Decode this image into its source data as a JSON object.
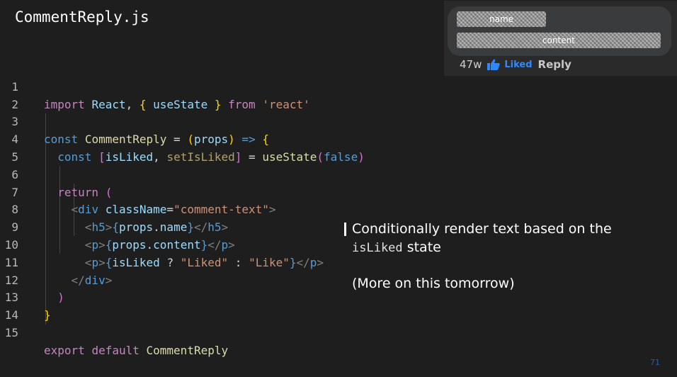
{
  "slide": {
    "title": "CommentReply.js",
    "page_number": "71"
  },
  "code": {
    "line_numbers": [
      "1",
      "2",
      "3",
      "4",
      "5",
      "6",
      "7",
      "8",
      "9",
      "10",
      "11",
      "12",
      "13",
      "14",
      "15"
    ],
    "tokens": {
      "import": "import",
      "React": "React",
      "comma": ",",
      "brace_open": "{",
      "useState": "useState",
      "brace_close": "}",
      "from": "from",
      "react_str": "'react'",
      "const": "const",
      "CommentReply": "CommentReply",
      "eq": "=",
      "paren_open": "(",
      "props": "props",
      "paren_close": ")",
      "arrow": "=>",
      "bracket_open": "[",
      "isLiked": "isLiked",
      "setIsLiked": "setIsLiked",
      "bracket_close": "]",
      "useState_call": "useState",
      "false": "false",
      "return": "return",
      "lt": "<",
      "gt": ">",
      "lt_slash": "</",
      "div": "div",
      "className": "className",
      "comment_text_str": "\"comment-text\"",
      "h5": "h5",
      "p": "p",
      "dot": ".",
      "name": "name",
      "content": "content",
      "question": "?",
      "liked_str": "\"Liked\"",
      "colon": ":",
      "like_str": "\"Like\"",
      "export": "export",
      "default": "default"
    }
  },
  "annotation": {
    "line1": "Conditionally render text based on the",
    "code_word": "isLiked",
    "line2_suffix": "state",
    "line3": "(More on this tomorrow)"
  },
  "preview": {
    "name_placeholder": "name",
    "content_placeholder": "content",
    "age": "47w",
    "liked_label": "Liked",
    "reply_label": "Reply",
    "thumb_icon": "thumbs-up-icon",
    "colors": {
      "liked": "#2e89ff",
      "card_bg": "#3a3b3c"
    }
  }
}
